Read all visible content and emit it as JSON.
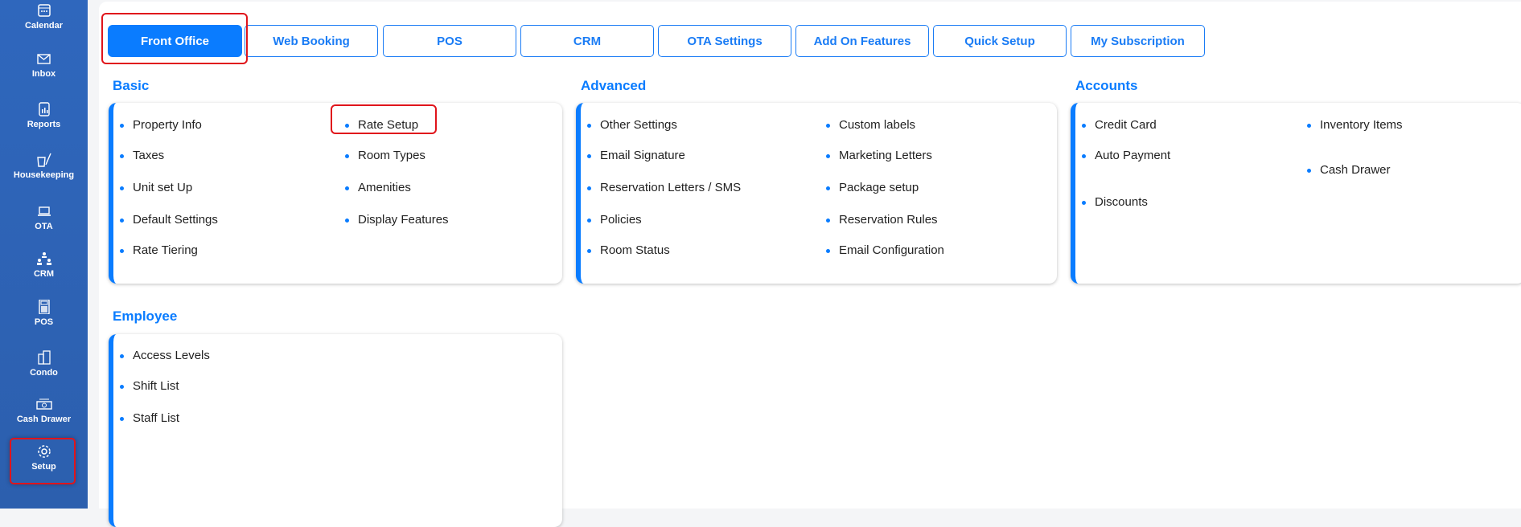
{
  "sidebar": {
    "items": [
      {
        "label": "Calendar",
        "icon": "calendar-icon"
      },
      {
        "label": "Inbox",
        "icon": "inbox-icon"
      },
      {
        "label": "Reports",
        "icon": "reports-icon"
      },
      {
        "label": "Housekeeping",
        "icon": "housekeeping-icon"
      },
      {
        "label": "OTA",
        "icon": "ota-icon"
      },
      {
        "label": "CRM",
        "icon": "crm-icon"
      },
      {
        "label": "POS",
        "icon": "pos-icon"
      },
      {
        "label": "Condo",
        "icon": "condo-icon"
      },
      {
        "label": "Cash Drawer",
        "icon": "cash-drawer-icon"
      },
      {
        "label": "Setup",
        "icon": "gear-icon"
      }
    ]
  },
  "tabs": [
    "Front Office",
    "Web Booking",
    "POS",
    "CRM",
    "OTA Settings",
    "Add On Features",
    "Quick Setup",
    "My Subscription"
  ],
  "sections": {
    "basic": {
      "title": "Basic",
      "col1": [
        "Property Info",
        "Taxes",
        "Unit set Up",
        "Default Settings",
        "Rate Tiering"
      ],
      "col2": [
        "Rate Setup",
        "Room Types",
        "Amenities",
        "Display Features"
      ]
    },
    "advanced": {
      "title": "Advanced",
      "col1": [
        "Other Settings",
        "Email Signature",
        "Reservation Letters / SMS",
        "Policies",
        "Room Status"
      ],
      "col2": [
        "Custom labels",
        "Marketing Letters",
        "Package setup",
        "Reservation Rules",
        "Email Configuration"
      ]
    },
    "accounts": {
      "title": "Accounts",
      "col1": [
        "Credit Card",
        "Auto Payment",
        "Discounts"
      ],
      "col2": [
        "Inventory Items",
        "Cash Drawer"
      ]
    },
    "employee": {
      "title": "Employee",
      "col1": [
        "Access Levels",
        "Shift List",
        "Staff List"
      ]
    }
  },
  "colors": {
    "accent": "#0a7cff",
    "sidebar": "#2f67bd",
    "highlight": "#e0141b"
  }
}
